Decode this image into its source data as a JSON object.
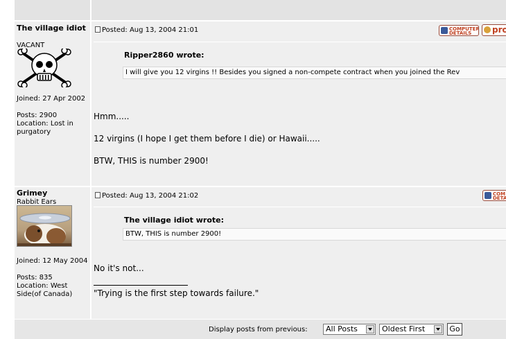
{
  "posts": [
    {
      "author": "The village idiot",
      "rank": "VACANT",
      "avatar_icon": "skull-crossbones-icon",
      "joined": "Joined: 27 Apr 2002",
      "posts": "Posts: 2900",
      "location": "Location: Lost in purgatory",
      "posted": "Posted: Aug 13, 2004 21:01",
      "buttons": [
        "COMPUTER DETAILS",
        "pro"
      ],
      "quote_author": "Ripper2860 wrote:",
      "quote_text": "I will give you 12 virgins !! Besides you signed a non-compete contract when you joined the Rev",
      "body": [
        "Hmm.....",
        "12 virgins (I hope I get them before I die) or Hawaii.....",
        "BTW, THIS is number 2900!"
      ]
    },
    {
      "author": "Grimey",
      "rank": "Rabbit Ears",
      "avatar_icon": "guinea-pig-photo",
      "joined": "Joined: 12 May 2004",
      "posts": "Posts: 835",
      "location": "Location: West Side(of Canada)",
      "posted": "Posted: Aug 13, 2004 21:02",
      "buttons": [
        "COM DETA"
      ],
      "quote_author": "The village idiot wrote:",
      "quote_text": "BTW, THIS is number 2900!",
      "body": [
        "No it's not...",
        "\"Trying is the first step towards failure.\""
      ]
    }
  ],
  "footer": {
    "display_label": "Display posts from previous:",
    "period_select": "All Posts",
    "order_select": "Oldest First",
    "go_label": "Go"
  }
}
